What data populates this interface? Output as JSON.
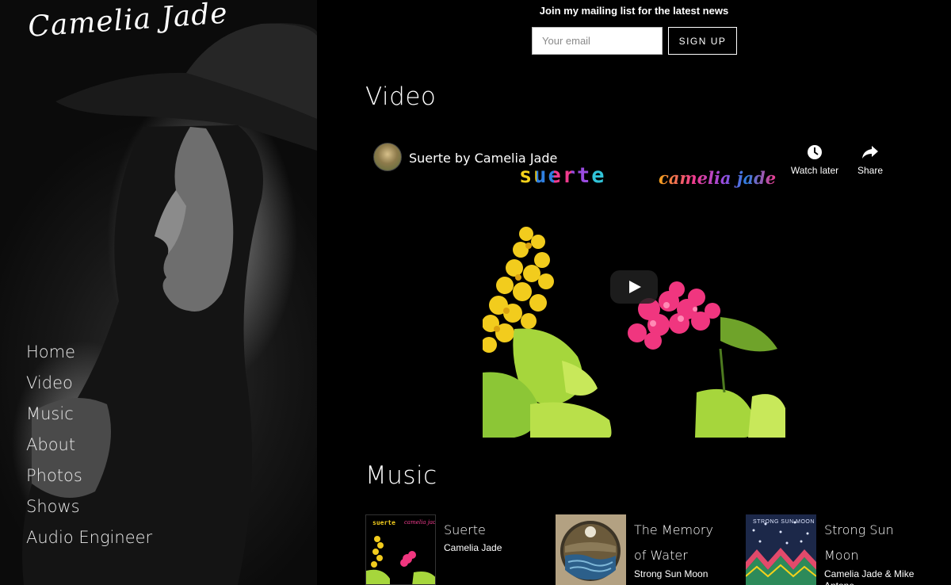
{
  "brand": {
    "logo_text": "Camelia Jade"
  },
  "nav": {
    "items": [
      {
        "label": "Home"
      },
      {
        "label": "Video"
      },
      {
        "label": "Music"
      },
      {
        "label": "About"
      },
      {
        "label": "Photos"
      },
      {
        "label": "Shows"
      },
      {
        "label": "Audio Engineer"
      }
    ]
  },
  "mailing": {
    "title": "Join my mailing list for the latest news",
    "email_placeholder": "Your email",
    "signup_label": "SIGN UP"
  },
  "video_section": {
    "heading": "Video",
    "embed": {
      "title": "Suerte by Camelia Jade",
      "overlay_word_left": "suerte",
      "overlay_word_right": "camelia jade",
      "watch_later_label": "Watch later",
      "share_label": "Share"
    }
  },
  "music_section": {
    "heading": "Music",
    "albums": [
      {
        "title": "Suerte",
        "artist": "Camelia Jade",
        "cover_words": [
          "suerte",
          "camelia jade"
        ]
      },
      {
        "title": "The Memory of Water",
        "artist": "Strong Sun Moon"
      },
      {
        "title": "Strong Sun Moon",
        "artist": "Camelia Jade & Mike Antone",
        "cover_words": [
          "STRONG SUN MOON"
        ]
      }
    ]
  },
  "colors": {
    "background": "#000000",
    "text": "#ffffff",
    "flower_yellow": "#f2cc1d",
    "flower_pink": "#f0367f",
    "leaf_green": "#a6d63c"
  }
}
